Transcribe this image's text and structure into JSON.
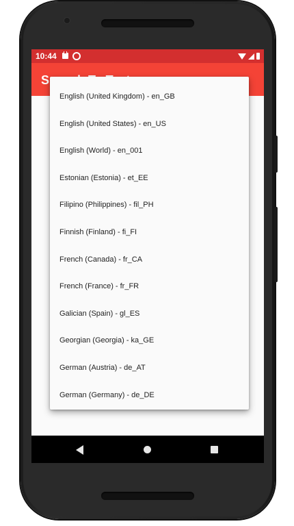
{
  "status_bar": {
    "time": "10:44"
  },
  "app_bar": {
    "title": "Speech To Text"
  },
  "dropdown": {
    "items": [
      "English (United Kingdom) - en_GB",
      "English (United States) - en_US",
      "English (World) - en_001",
      "Estonian (Estonia) - et_EE",
      "Filipino (Philippines) - fil_PH",
      "Finnish (Finland) - fi_FI",
      "French (Canada) - fr_CA",
      "French (France) - fr_FR",
      "Galician (Spain) - gl_ES",
      "Georgian (Georgia) - ka_GE",
      "German (Austria) - de_AT",
      "German (Germany) - de_DE"
    ]
  },
  "colors": {
    "status_bar": "#d32f2f",
    "app_bar": "#f44336",
    "surface": "#fafafa"
  },
  "icons": {
    "status": [
      "sim-icon",
      "sync-icon",
      "wifi-icon",
      "signal-icon",
      "battery-icon"
    ],
    "navigation": [
      "back-icon",
      "home-icon",
      "recents-icon"
    ]
  }
}
